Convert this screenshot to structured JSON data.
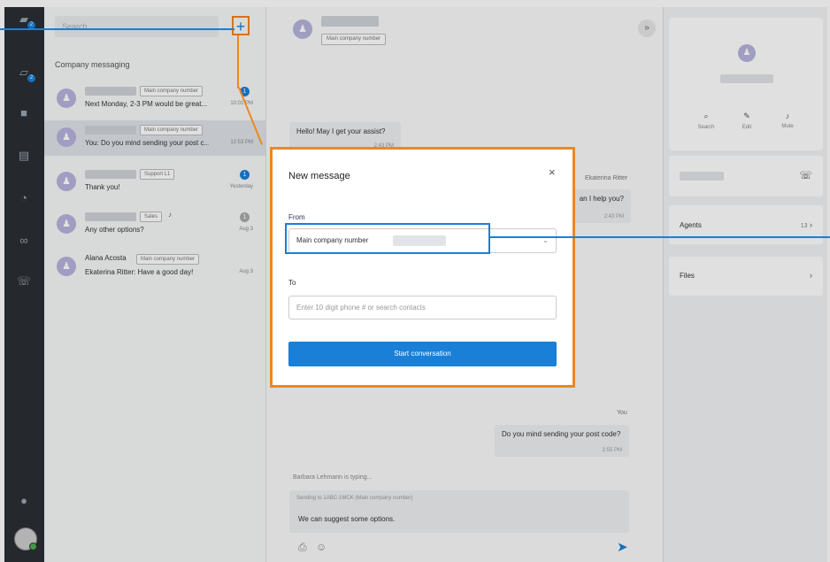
{
  "search": {
    "placeholder": "Search..."
  },
  "list": {
    "section_label": "Company messaging",
    "conversations": [
      {
        "tag": "Main company number",
        "preview": "Next Monday, 2-3 PM would be great...",
        "time": "10:01 PM",
        "unread": "1"
      },
      {
        "tag": "Main company number",
        "preview": "You: Do you mind sending your post c...",
        "time": "12:53 PM",
        "unread": ""
      },
      {
        "tag": "Support L1",
        "preview": "Thank you!",
        "time": "Yesterday",
        "unread": "1"
      },
      {
        "tag": "Sales",
        "preview": "Any other options?",
        "time": "Aug 3",
        "unread": "1"
      },
      {
        "name": "Alana Acosta",
        "tag": "Main company number",
        "preview": "Ekaterina Ritter: Have a good day!",
        "time": "Aug 3",
        "unread": ""
      }
    ]
  },
  "chat": {
    "header_tag": "Main company number",
    "messages": [
      {
        "text": "Hello! May I get your assist?",
        "time": "2:43 PM"
      },
      {
        "sender": "Ekaterina Ritter",
        "text": "an I help you?",
        "time": "2:43 PM"
      },
      {
        "sender": "You",
        "text": "Do you mind sending your post code?",
        "time": "2:55 PM"
      }
    ],
    "typing": "Barbara Lehmann is typing...",
    "sending": "Sending to 1ABC-1MCK (Main company number)",
    "draft": "We can suggest some options."
  },
  "panel": {
    "actions": [
      {
        "label": "Search",
        "icon": "search-icon"
      },
      {
        "label": "Edit",
        "icon": "edit-icon"
      },
      {
        "label": "Mute",
        "icon": "mute-icon"
      }
    ],
    "agents_label": "Agents",
    "agents_count": "13",
    "files_label": "Files"
  },
  "modal": {
    "title": "New message",
    "from_label": "From",
    "from_value": "Main company number",
    "to_label": "To",
    "to_placeholder": "Enter 10 digit phone # or search contacts",
    "button_label": "Start conversation"
  },
  "colors": {
    "accent": "#1a7fd6",
    "highlight": "#f0861e",
    "rail": "#2b2f35"
  }
}
